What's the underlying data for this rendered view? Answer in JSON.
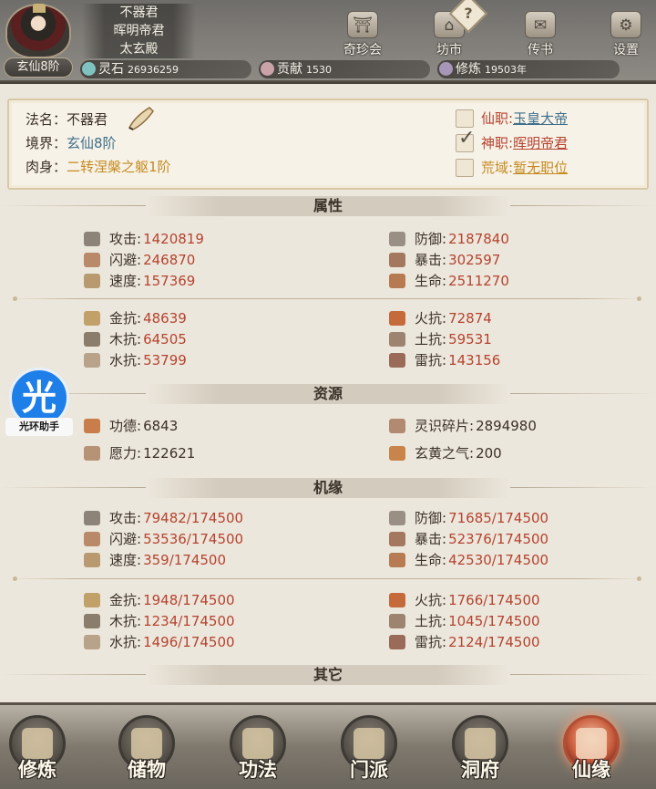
{
  "player": {
    "titles": [
      "不器君",
      "晖明帝君",
      "太玄殿"
    ],
    "realm_badge": "玄仙8阶"
  },
  "resources_bar": [
    {
      "label": "灵石",
      "value": "26936259",
      "icon": "spirit-stone-icon",
      "color": "#7fc3c0"
    },
    {
      "label": "贡献",
      "value": "1530",
      "icon": "contribution-icon",
      "color": "#c9a3a8"
    },
    {
      "label": "修炼",
      "value": "19503年",
      "icon": "cultivation-icon",
      "color": "#a696b8"
    }
  ],
  "top_nav": [
    {
      "label": "奇珍会",
      "icon": "treasure-pavilion-icon",
      "glyph": "⛩"
    },
    {
      "label": "坊市",
      "icon": "market-icon",
      "glyph": "⌂"
    },
    {
      "label": "传书",
      "icon": "scroll-letter-icon",
      "glyph": "✉"
    },
    {
      "label": "设置",
      "icon": "gear-icon",
      "glyph": "⚙"
    }
  ],
  "info": {
    "dharma_name_label": "法名：",
    "dharma_name": "不器君",
    "realm_label": "境界：",
    "realm": "玄仙8阶",
    "body_label": "肉身：",
    "body": "二转涅槃之躯1阶",
    "posts": [
      {
        "key": "仙职:",
        "value": "玉皇大帝",
        "checked": false
      },
      {
        "key": "神职:",
        "value": "晖明帝君",
        "checked": true
      },
      {
        "key": "荒域:",
        "value": "暂无职位",
        "checked": false
      }
    ]
  },
  "sections": {
    "attributes": "属性",
    "resources": "资源",
    "fortune": "机缘",
    "other": "其它"
  },
  "attributes": {
    "combat_left": [
      {
        "label": "攻击:",
        "value": "1420819"
      },
      {
        "label": "闪避:",
        "value": "246870"
      },
      {
        "label": "速度:",
        "value": "157369"
      }
    ],
    "combat_right": [
      {
        "label": "防御:",
        "value": "2187840"
      },
      {
        "label": "暴击:",
        "value": "302597"
      },
      {
        "label": "生命:",
        "value": "2511270"
      }
    ],
    "resist_left": [
      {
        "label": "金抗:",
        "value": "48639"
      },
      {
        "label": "木抗:",
        "value": "64505"
      },
      {
        "label": "水抗:",
        "value": "53799"
      }
    ],
    "resist_right": [
      {
        "label": "火抗:",
        "value": "72874"
      },
      {
        "label": "土抗:",
        "value": "59531"
      },
      {
        "label": "雷抗:",
        "value": "143156"
      }
    ]
  },
  "resources": {
    "left": [
      {
        "label": "功德:",
        "value": "6843"
      },
      {
        "label": "愿力:",
        "value": "122621"
      }
    ],
    "right": [
      {
        "label": "灵识碎片:",
        "value": "2894980"
      },
      {
        "label": "玄黄之气:",
        "value": "200"
      }
    ]
  },
  "fortune": {
    "help": "?",
    "combat_left": [
      {
        "label": "攻击:",
        "value": "79482/174500"
      },
      {
        "label": "闪避:",
        "value": "53536/174500"
      },
      {
        "label": "速度:",
        "value": "359/174500"
      }
    ],
    "combat_right": [
      {
        "label": "防御:",
        "value": "71685/174500"
      },
      {
        "label": "暴击:",
        "value": "52376/174500"
      },
      {
        "label": "生命:",
        "value": "42530/174500"
      }
    ],
    "resist_left": [
      {
        "label": "金抗:",
        "value": "1948/174500"
      },
      {
        "label": "木抗:",
        "value": "1234/174500"
      },
      {
        "label": "水抗:",
        "value": "1496/174500"
      }
    ],
    "resist_right": [
      {
        "label": "火抗:",
        "value": "1766/174500"
      },
      {
        "label": "土抗:",
        "value": "1045/174500"
      },
      {
        "label": "雷抗:",
        "value": "2124/174500"
      }
    ]
  },
  "helper": {
    "glyph": "光",
    "caption": "光环助手"
  },
  "bottom_nav": [
    {
      "label": "修炼",
      "icon": "meditation-icon",
      "active": false
    },
    {
      "label": "储物",
      "icon": "storage-bag-icon",
      "active": false
    },
    {
      "label": "功法",
      "icon": "technique-scroll-icon",
      "active": false
    },
    {
      "label": "门派",
      "icon": "sect-gate-icon",
      "active": false
    },
    {
      "label": "洞府",
      "icon": "cave-dwelling-icon",
      "active": false
    },
    {
      "label": "仙缘",
      "icon": "immortal-fate-icon",
      "active": true
    }
  ],
  "colors": {
    "value_red": "#b5432f",
    "link_blue": "#3f6f8a",
    "gold": "#c58a20",
    "active_nav": "#c85a3a"
  }
}
